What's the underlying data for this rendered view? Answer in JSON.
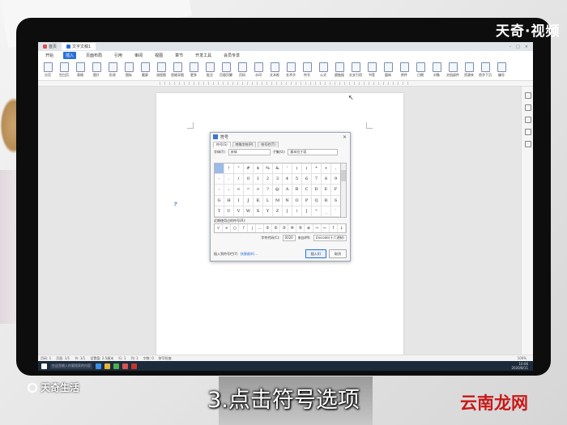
{
  "watermark_top": "天奇·视频",
  "window": {
    "tabs": [
      {
        "label": "首页",
        "color": "#d9534f"
      },
      {
        "label": "文字文稿1",
        "color": "#2b6fd6"
      }
    ],
    "menu": [
      "开始",
      "插入",
      "页面布局",
      "引用",
      "审阅",
      "视图",
      "章节",
      "开发工具",
      "会员专享"
    ],
    "menu_selected_index": 1,
    "ribbon_items": [
      "分页",
      "空白页",
      "表格",
      "图片",
      "形状",
      "图标",
      "截屏",
      "流程图",
      "思维导图",
      "更多",
      "批注",
      "页眉页脚",
      "页码",
      "水印",
      "文本框",
      "艺术字",
      "符号",
      "公式",
      "超链接",
      "交叉引用",
      "书签",
      "窗体",
      "附件",
      "日期",
      "对象",
      "文档部件",
      "资源夹",
      "首字下沉",
      "编号"
    ]
  },
  "dialog": {
    "title": "符号",
    "tabs": [
      "符号(S)",
      "特殊字符(P)",
      "符号栏(T)"
    ],
    "font_label": "字体(F):",
    "font_value": "宋体",
    "subset_label": "子集(U):",
    "subset_value": "基本拉丁语",
    "symbols": [
      "",
      "!",
      "\"",
      "#",
      "$",
      "%",
      "&",
      "'",
      "(",
      ")",
      "*",
      "+",
      ",",
      "-",
      ".",
      "/",
      "0",
      "1",
      "2",
      "3",
      "4",
      "5",
      "6",
      "7",
      "8",
      "9",
      ":",
      ";",
      "<",
      "=",
      ">",
      "?",
      "@",
      "A",
      "B",
      "C",
      "D",
      "E",
      "F",
      "G",
      "H",
      "I",
      "J",
      "K",
      "L",
      "M",
      "N",
      "O",
      "P",
      "Q",
      "R",
      "S",
      "T",
      "U",
      "V",
      "W",
      "X",
      "Y",
      "Z",
      "[",
      "\\",
      "]",
      "^",
      "_",
      "`"
    ],
    "recent_label": "近期使用过的符号(R):",
    "recent_symbols": [
      "√",
      "×",
      "○",
      "「",
      "〔",
      "…",
      "①",
      "②",
      "③",
      "④",
      "⑤",
      "※",
      "→",
      "←",
      "↑",
      "↓"
    ],
    "code_label": "字符代码(C):",
    "code_value": "0020",
    "from_label": "来自(M):",
    "from_value": "Unicode(十六进制)",
    "insert_to_bar": "插入到符号栏(Y)",
    "shortcut_link": "快捷键(K)...",
    "insert_button": "插入(I)",
    "cancel_button": "取消"
  },
  "statusbar": {
    "page": "页码: 1",
    "pages": "页面: 1/1",
    "section": "节: 1/1",
    "position": "设置值: 2.5厘米",
    "row": "行: 1",
    "col": "列: 1",
    "words": "字数: 0",
    "spell": "拼写检查",
    "zoom": "100%"
  },
  "taskbar": {
    "search": "在这里输入你要搜索的内容",
    "time": "10:06",
    "date": "2020/8/11"
  },
  "caption": "3.点击符号选项",
  "watermark_bottom_left": "天奇生活",
  "watermark_bottom_right": "云南龙网"
}
